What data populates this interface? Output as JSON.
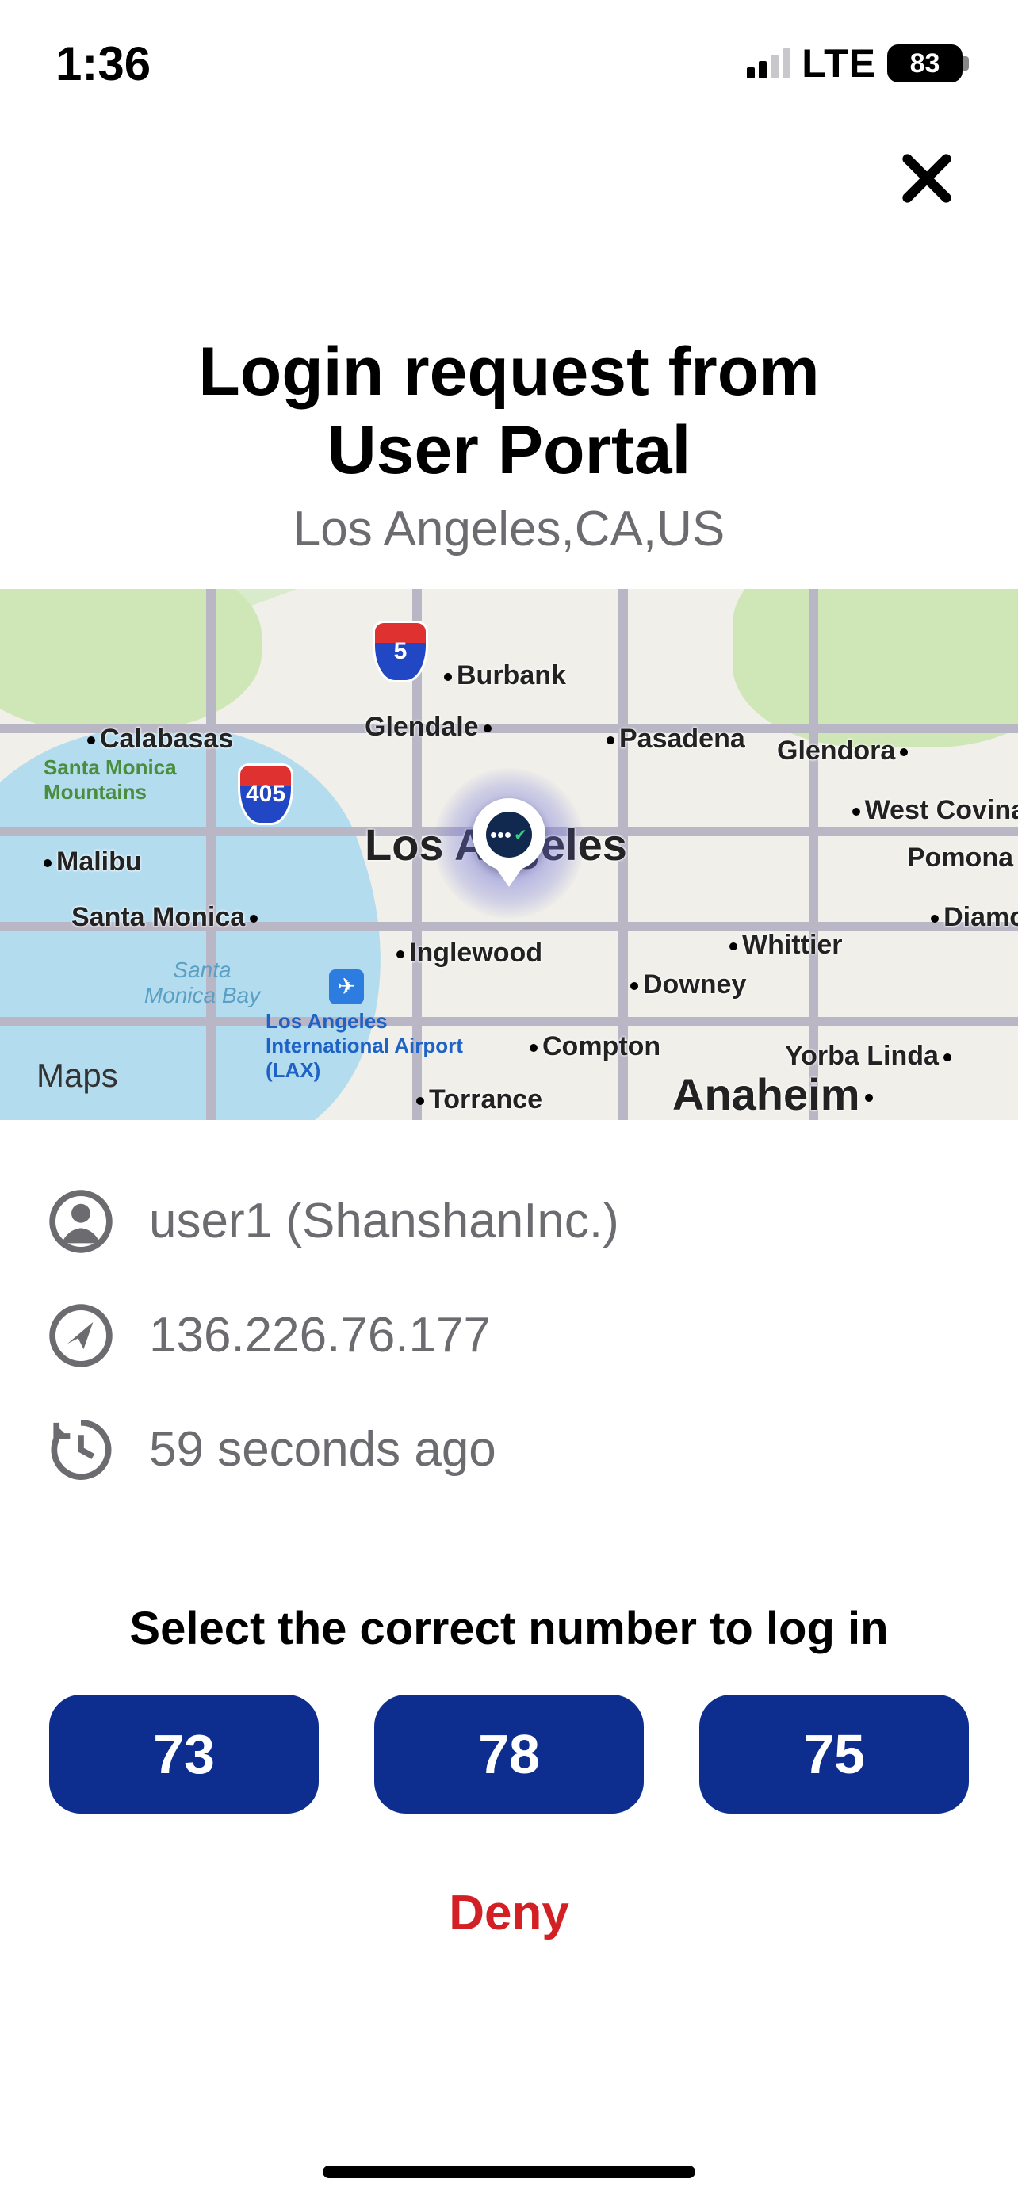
{
  "status_bar": {
    "time": "1:36",
    "network": "LTE",
    "battery_pct": "83"
  },
  "header": {
    "title_line1": "Login request from",
    "title_line2": "User Portal",
    "subtitle": "Los Angeles,CA,US"
  },
  "map": {
    "attribution": "Maps",
    "pin_label": "Los Angeles",
    "shields": {
      "i5": "5",
      "i405": "405"
    },
    "airport_label": "Los Angeles International Airport (LAX)",
    "park_label": "Santa Monica Mountains",
    "bay_label": "Santa Monica Bay",
    "cities": {
      "burbank": "Burbank",
      "glendale": "Glendale",
      "calabasas": "Calabasas",
      "pasadena": "Pasadena",
      "glendora": "Glendora",
      "west_covina": "West Covina",
      "pomona": "Pomona",
      "diamond": "Diamo",
      "whittier": "Whittier",
      "downey": "Downey",
      "compton": "Compton",
      "inglewood": "Inglewood",
      "malibu": "Malibu",
      "santa_monica": "Santa Monica",
      "torrance": "Torrance",
      "anaheim": "Anaheim",
      "yorba_linda": "Yorba Linda",
      "los_angeles": "Los Angeles"
    }
  },
  "info": {
    "user": "user1 (ShanshanInc.)",
    "ip": "136.226.76.177",
    "time_ago": "59 seconds ago"
  },
  "challenge": {
    "prompt": "Select the correct number to log in",
    "options": [
      "73",
      "78",
      "75"
    ],
    "deny_label": "Deny"
  }
}
